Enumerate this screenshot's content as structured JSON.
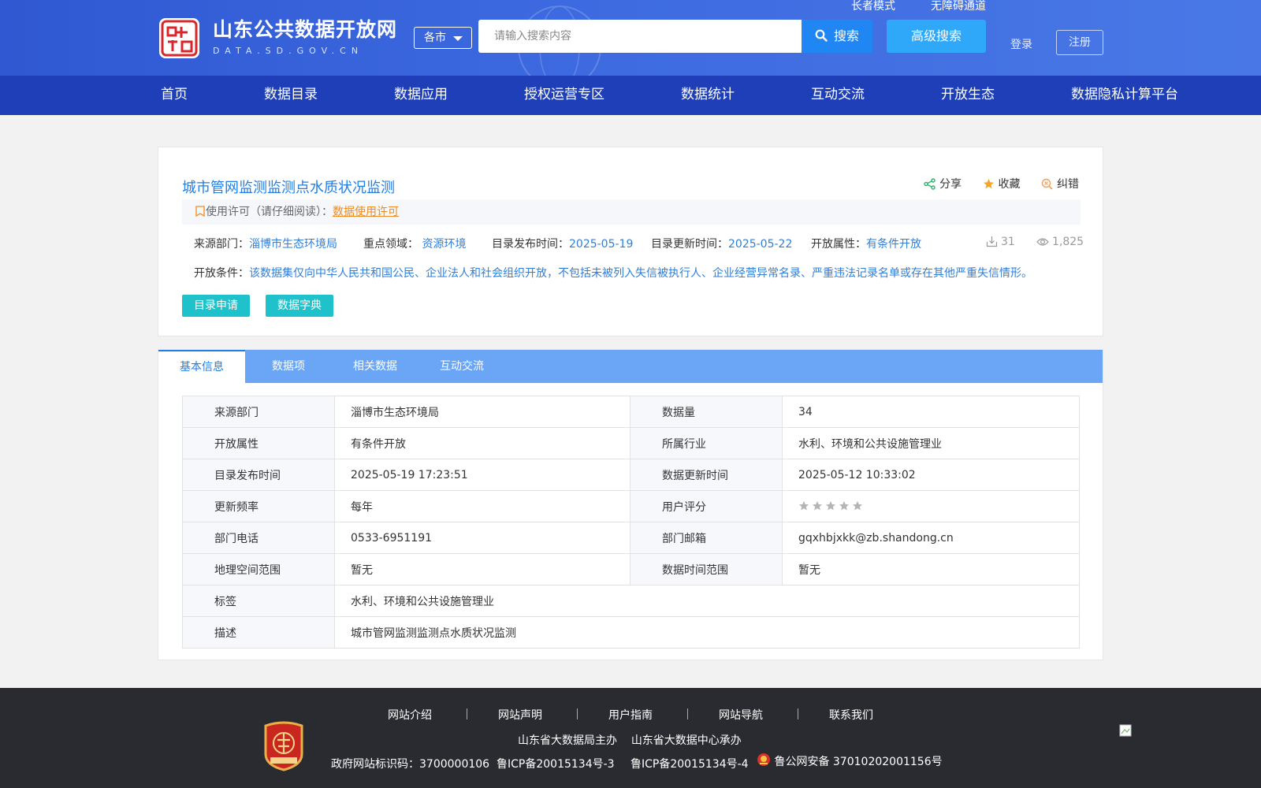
{
  "header": {
    "site_name": "山东公共数据开放网",
    "site_domain": "DATA.SD.GOV.CN",
    "city_select": "各市",
    "search_placeholder": "请输入搜索内容",
    "search_button": "搜索",
    "advanced_search": "高级搜索",
    "elder_mode": "长者模式",
    "accessibility": "无障碍通道",
    "login": "登录",
    "register": "注册"
  },
  "nav": [
    "首页",
    "数据目录",
    "数据应用",
    "授权运营专区",
    "数据统计",
    "互动交流",
    "开放生态",
    "数据隐私计算平台"
  ],
  "dataset": {
    "title": "城市管网监测监测点水质状况监测",
    "actions": {
      "share": "分享",
      "favorite": "收藏",
      "report": "纠错"
    },
    "license_label": "使用许可（请仔细阅读）：",
    "license_link": "数据使用许可",
    "meta": {
      "source_label": "来源部门：",
      "source": "淄博市生态环境局",
      "domain_label": "重点领域：",
      "domain": "资源环境",
      "publish_label": "目录发布时间：",
      "publish": "2025-05-19",
      "update_label": "目录更新时间：",
      "update": "2025-05-22",
      "open_label": "开放属性：",
      "open": "有条件开放",
      "downloads": "31",
      "views": "1,825"
    },
    "condition_label": "开放条件：",
    "condition": "该数据集仅向中华人民共和国公民、企业法人和社会组织开放，不包括未被列入失信被执行人、企业经营异常名录、严重违法记录名单或存在其他严重失信情形。",
    "buttons": {
      "apply": "目录申请",
      "dictionary": "数据字典"
    }
  },
  "tabs": [
    "基本信息",
    "数据项",
    "相关数据",
    "互动交流"
  ],
  "info": {
    "rows": [
      {
        "k1": "来源部门",
        "v1": "淄博市生态环境局",
        "k2": "数据量",
        "v2": "34"
      },
      {
        "k1": "开放属性",
        "v1": "有条件开放",
        "k2": "所属行业",
        "v2": "水利、环境和公共设施管理业"
      },
      {
        "k1": "目录发布时间",
        "v1": "2025-05-19 17:23:51",
        "k2": "数据更新时间",
        "v2": "2025-05-12 10:33:02"
      },
      {
        "k1": "更新频率",
        "v1": "每年",
        "k2": "用户评分",
        "v2": ""
      },
      {
        "k1": "部门电话",
        "v1": "0533-6951191",
        "k2": "部门邮箱",
        "v2": "gqxhbjxkk@zb.shandong.cn"
      },
      {
        "k1": "地理空间范围",
        "v1": "暂无",
        "k2": "数据时间范围",
        "v2": "暂无"
      }
    ],
    "tag_label": "标签",
    "tag": "水利、环境和公共设施管理业",
    "desc_label": "描述",
    "desc": "城市管网监测监测点水质状况监测",
    "rating_stars": 5,
    "rating_value": 0
  },
  "footer": {
    "links": [
      "网站介绍",
      "网站声明",
      "用户指南",
      "网站导航",
      "联系我们"
    ],
    "sponsor": "山东省大数据局主办",
    "organizer": "山东省大数据中心承办",
    "gov_code": "政府网站标识码：3700000106",
    "icp3": "鲁ICP备20015134号-3",
    "icp4": "鲁ICP备20015134号-4",
    "police": "鲁公网安备 37010202001156号"
  },
  "colors": {
    "brand_blue": "#1f7ee8",
    "nav_bg": "#1e3fb8",
    "teal": "#1fc1cb",
    "orange": "#f08b1d"
  }
}
